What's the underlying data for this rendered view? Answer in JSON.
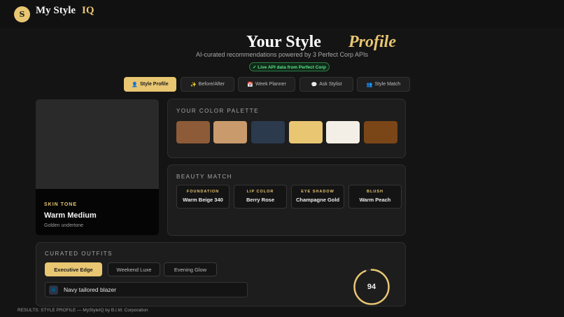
{
  "header": {
    "logo_initial": "S",
    "brand": "My Style",
    "brand_suffix": "IQ"
  },
  "hero": {
    "title": "Your Style",
    "title_accent": "Profile",
    "subtitle": "AI-curated recommendations powered by 3 Perfect Corp APIs",
    "live_badge": "✓ Live API data from Perfect Corp"
  },
  "tabs": [
    {
      "icon": "👤",
      "label": "Style Profile",
      "active": true
    },
    {
      "icon": "✨",
      "label": "Before/After",
      "active": false
    },
    {
      "icon": "📅",
      "label": "Week Planner",
      "active": false
    },
    {
      "icon": "💬",
      "label": "Ask Stylist",
      "active": false
    },
    {
      "icon": "👥",
      "label": "Style Match",
      "active": false
    }
  ],
  "skin": {
    "label": "SKIN TONE",
    "value": "Warm Medium",
    "undertone": "Golden undertone"
  },
  "palette": {
    "title": "YOUR COLOR PALETTE",
    "colors": [
      "#8e5b38",
      "#c99b6c",
      "#2b3a4d",
      "#e8c672",
      "#f4efe6",
      "#7b4617"
    ]
  },
  "beauty": {
    "title": "BEAUTY MATCH",
    "items": [
      {
        "label": "FOUNDATION",
        "value": "Warm Beige 340"
      },
      {
        "label": "LIP COLOR",
        "value": "Berry Rose"
      },
      {
        "label": "EYE SHADOW",
        "value": "Champagne Gold"
      },
      {
        "label": "BLUSH",
        "value": "Warm Peach"
      }
    ]
  },
  "outfits": {
    "title": "CURATED OUTFITS",
    "tabs": [
      {
        "label": "Executive Edge",
        "active": true
      },
      {
        "label": "Weekend Luxe",
        "active": false
      },
      {
        "label": "Evening Glow",
        "active": false
      }
    ],
    "items": [
      {
        "icon": "blazer-icon",
        "glyph": "🧥",
        "label": "Navy tailored blazer"
      }
    ],
    "score": 94
  },
  "footer": "RESULTS: STYLE PROFILE — MyStyleIQ by B.I.M. Corporation",
  "colors": {
    "accent": "#e8c672",
    "background": "#141414",
    "panel": "#1d1d1d",
    "live_green": "#5ee08a"
  }
}
